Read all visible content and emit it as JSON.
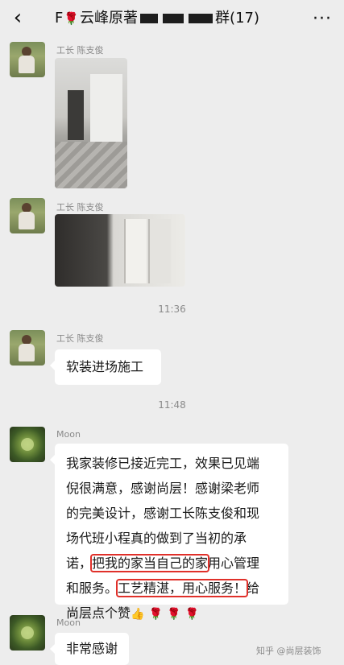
{
  "header": {
    "back_icon": "chevron-left-icon",
    "title_prefix": "F",
    "title_name": "云峰原著",
    "title_suffix": "群(17)",
    "more_icon": "more-dots-icon"
  },
  "messages": [
    {
      "sender": "工长 陈支俊",
      "type": "image",
      "image": "photo"
    },
    {
      "sender": "工长 陈支俊",
      "type": "image",
      "image": "photo"
    },
    {
      "sender": "工长 陈支俊",
      "type": "text",
      "text": "软装进场施工"
    },
    {
      "sender": "Moon",
      "type": "text",
      "line1": "我家装修已接近完工，效果已见端",
      "line2": "倪很满意，感谢尚层！感谢梁老师",
      "line3": "的完美设计，感谢工长陈支俊和现",
      "line4": "场代班小程真的做到了当初的承",
      "line5_pre": "诺，",
      "line5_hl": "把我的家当自己的家",
      "line5_post": "用心管理",
      "line6_pre": "和服务。",
      "line6_hl": "工艺精湛，用心服务！",
      "line6_post": "给",
      "line7": "尚层点个赞"
    },
    {
      "sender": "Moon",
      "type": "text",
      "text": "非常感谢"
    }
  ],
  "timestamps": [
    "11:36",
    "11:48"
  ],
  "watermark": "知乎 @尚层装饰",
  "colors": {
    "background": "#ededed",
    "bubble": "#ffffff",
    "highlight": "#e0302a"
  }
}
